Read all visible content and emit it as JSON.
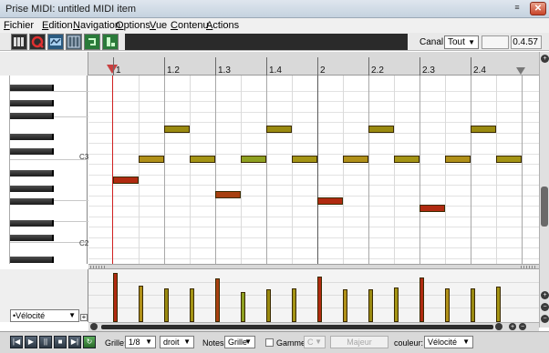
{
  "window": {
    "title": "Prise MIDI: untitled MIDI item"
  },
  "menu": [
    {
      "label": "Fichier"
    },
    {
      "label": "Edition"
    },
    {
      "label": "Navigation"
    },
    {
      "label": "Options"
    },
    {
      "label": "Vue"
    },
    {
      "label": "Contenu"
    },
    {
      "label": "Actions"
    }
  ],
  "toolbar": {
    "channel_label": "Canal:",
    "channel_value": "Tout",
    "position": "0.4.57"
  },
  "ruler": {
    "labels": [
      "1",
      "1.2",
      "1.3",
      "1.4",
      "2",
      "2.2",
      "2.3",
      "2.4"
    ]
  },
  "piano": {
    "labels": [
      "C3",
      "C2"
    ]
  },
  "notes_colors": {
    "high": "#8a7a10",
    "mid": "#b09018",
    "low": "#b03010"
  },
  "velocity_lane": {
    "selector": "•Vélocité"
  },
  "bottom": {
    "grid_label": "Grille:",
    "grid_value": "1/8",
    "grid_mode": "droit",
    "notes_label": "Notes:",
    "notes_value": "Grille",
    "scale_label": "Gamme:",
    "scale_root": "C",
    "scale_type": "Majeur",
    "color_label": "couleur:",
    "color_value": "Vélocité"
  }
}
